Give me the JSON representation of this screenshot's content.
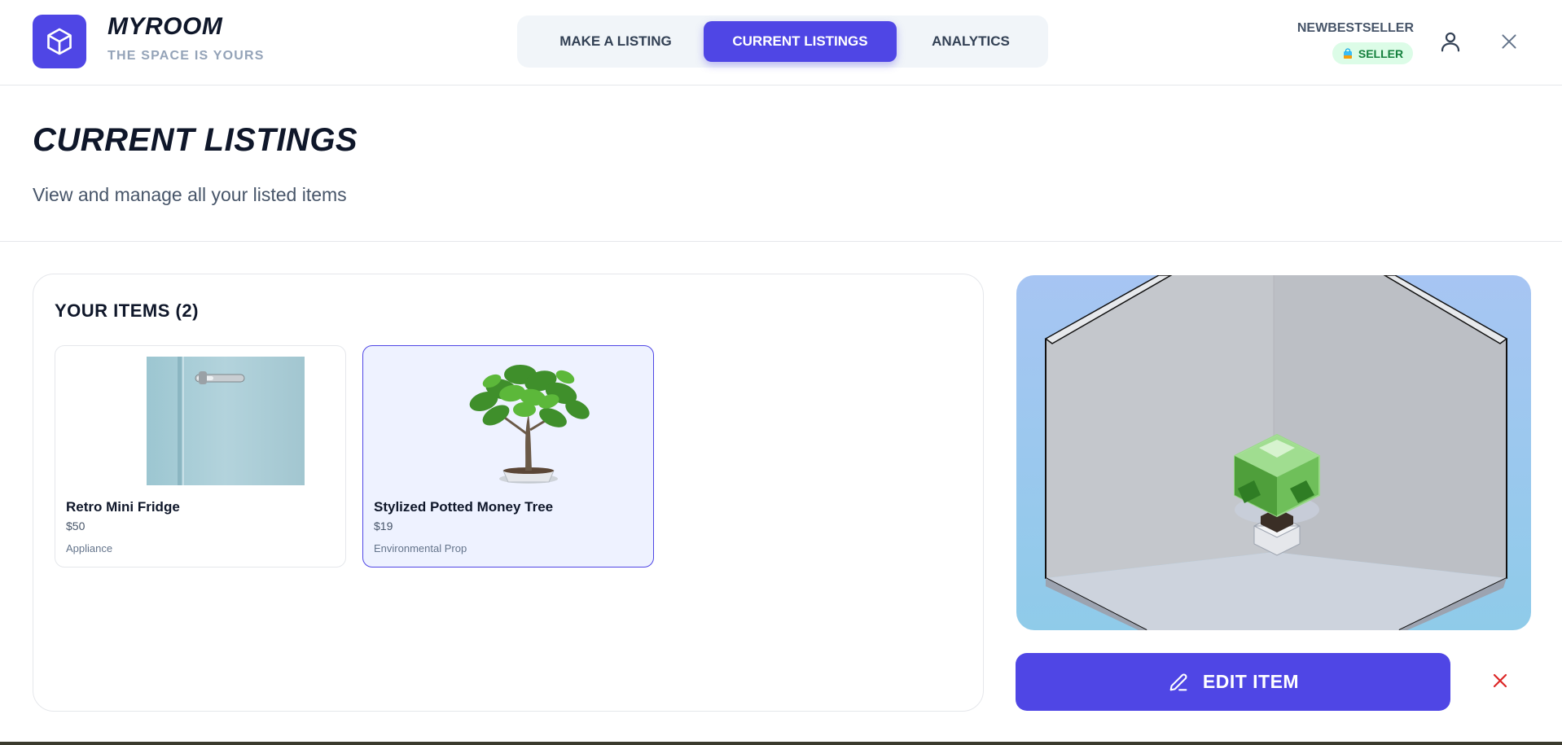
{
  "brand": {
    "title": "MYROOM",
    "subtitle": "THE SPACE IS YOURS"
  },
  "nav": {
    "tabs": [
      {
        "label": "MAKE A LISTING"
      },
      {
        "label": "CURRENT LISTINGS",
        "active": true
      },
      {
        "label": "ANALYTICS"
      }
    ]
  },
  "user": {
    "name": "NEWBESTSELLER",
    "badge": "SELLER"
  },
  "page": {
    "title": "CURRENT LISTINGS",
    "subtitle": "View and manage all your listed items"
  },
  "items_panel": {
    "heading": "YOUR ITEMS (2)",
    "items": [
      {
        "name": "Retro Mini Fridge",
        "price": "$50",
        "category": "Appliance",
        "image": "fridge-image"
      },
      {
        "name": "Stylized Potted Money Tree",
        "price": "$19",
        "category": "Environmental Prop",
        "image": "tree-image",
        "selected": true
      }
    ]
  },
  "actions": {
    "edit_label": "EDIT ITEM"
  },
  "colors": {
    "accent": "#4f46e5",
    "badge_bg": "#dcfce7",
    "badge_text": "#15803d",
    "delete": "#dc2626"
  }
}
